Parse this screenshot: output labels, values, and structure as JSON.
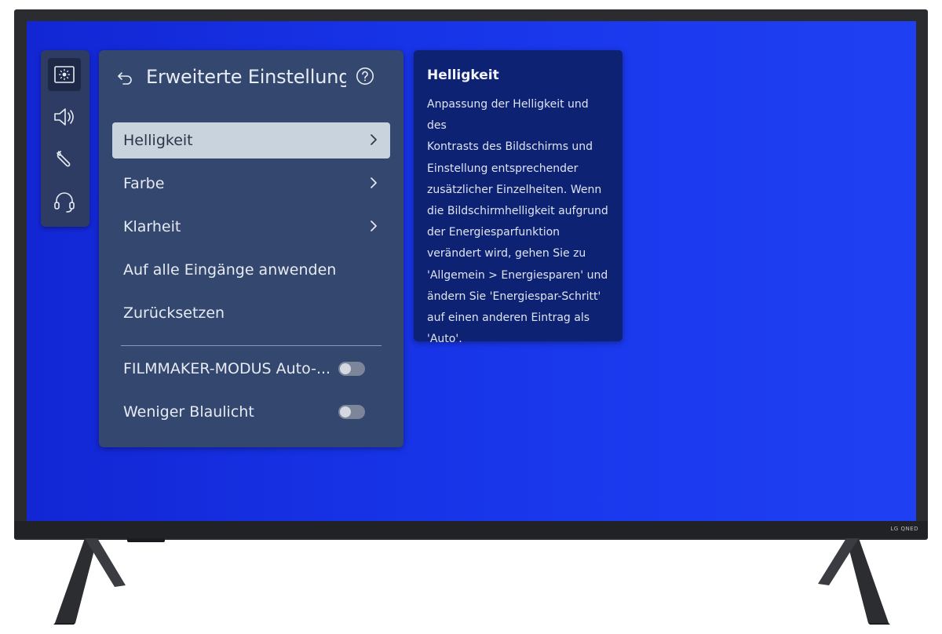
{
  "tv": {
    "brand": "LG QNED"
  },
  "rail": {
    "items": [
      {
        "icon": "picture-settings-icon",
        "active": true
      },
      {
        "icon": "speaker-icon",
        "active": false
      },
      {
        "icon": "wrench-icon",
        "active": false
      },
      {
        "icon": "headset-icon",
        "active": false
      }
    ]
  },
  "panel": {
    "title": "Erweiterte Einstellung",
    "back_icon": "back-arrow-icon",
    "help_icon": "help-icon",
    "items": [
      {
        "label": "Helligkeit",
        "selected": true,
        "has_chevron": true
      },
      {
        "label": "Farbe",
        "selected": false,
        "has_chevron": true
      },
      {
        "label": "Klarheit",
        "selected": false,
        "has_chevron": true
      },
      {
        "label": "Auf alle Eingänge anwenden",
        "selected": false,
        "has_chevron": false
      },
      {
        "label": "Zurücksetzen",
        "selected": false,
        "has_chevron": false
      }
    ],
    "toggles": [
      {
        "label": "FILMMAKER-MODUS Auto-...",
        "on": false
      },
      {
        "label": "Weniger Blaulicht",
        "on": false
      }
    ]
  },
  "info": {
    "title": "Helligkeit",
    "lines": [
      "Anpassung der Helligkeit und des",
      "Kontrasts des Bildschirms und",
      "Einstellung entsprechender",
      "zusätzlicher Einzelheiten. Wenn",
      "die Bildschirmhelligkeit aufgrund",
      "der Energiesparfunktion",
      "verändert wird, gehen Sie zu",
      "'Allgemein > Energiesparen' und",
      "ändern Sie 'Energiespar-Schritt'",
      "auf einen anderen Eintrag als",
      "'Auto'."
    ]
  },
  "colors": {
    "screen_blue": "#1733e6",
    "panel_bg": "#34476e",
    "info_bg": "#0d2272",
    "selected_bg": "#c9d3de"
  }
}
